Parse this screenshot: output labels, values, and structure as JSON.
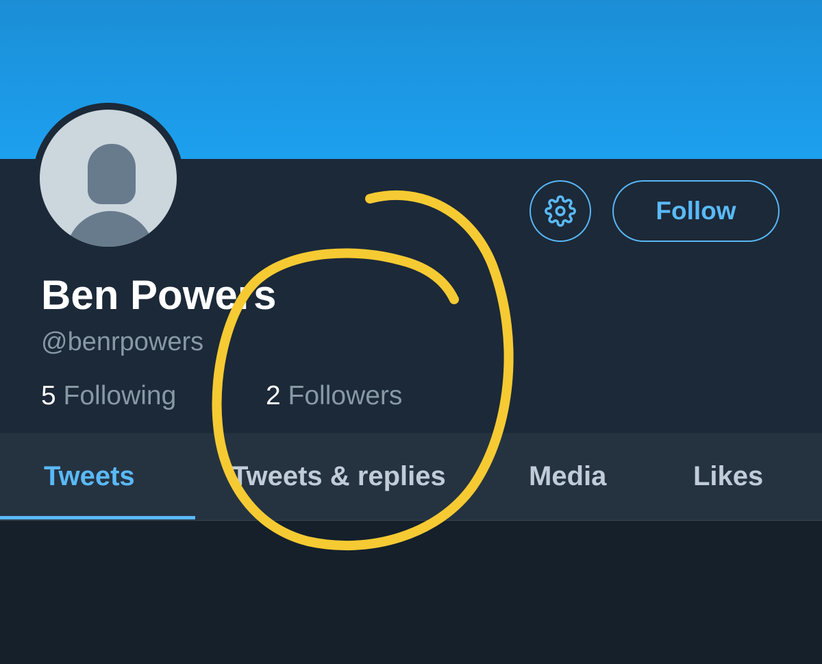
{
  "profile": {
    "name": "Ben Powers",
    "handle": "@benrpowers",
    "following_count": "5",
    "following_label": "Following",
    "followers_count": "2",
    "followers_label": "Followers"
  },
  "actions": {
    "settings_icon": "gear-icon",
    "follow_label": "Follow"
  },
  "tabs": [
    {
      "label": "Tweets",
      "active": true
    },
    {
      "label": "Tweets & replies",
      "active": false
    },
    {
      "label": "Media",
      "active": false
    },
    {
      "label": "Likes",
      "active": false
    }
  ],
  "colors": {
    "banner": "#1da1f2",
    "background": "#15202b",
    "profile_panel": "#1c2938",
    "tab_bar": "#253341",
    "accent": "#5ab9f8",
    "annotation_circle": "#f6ca32"
  }
}
